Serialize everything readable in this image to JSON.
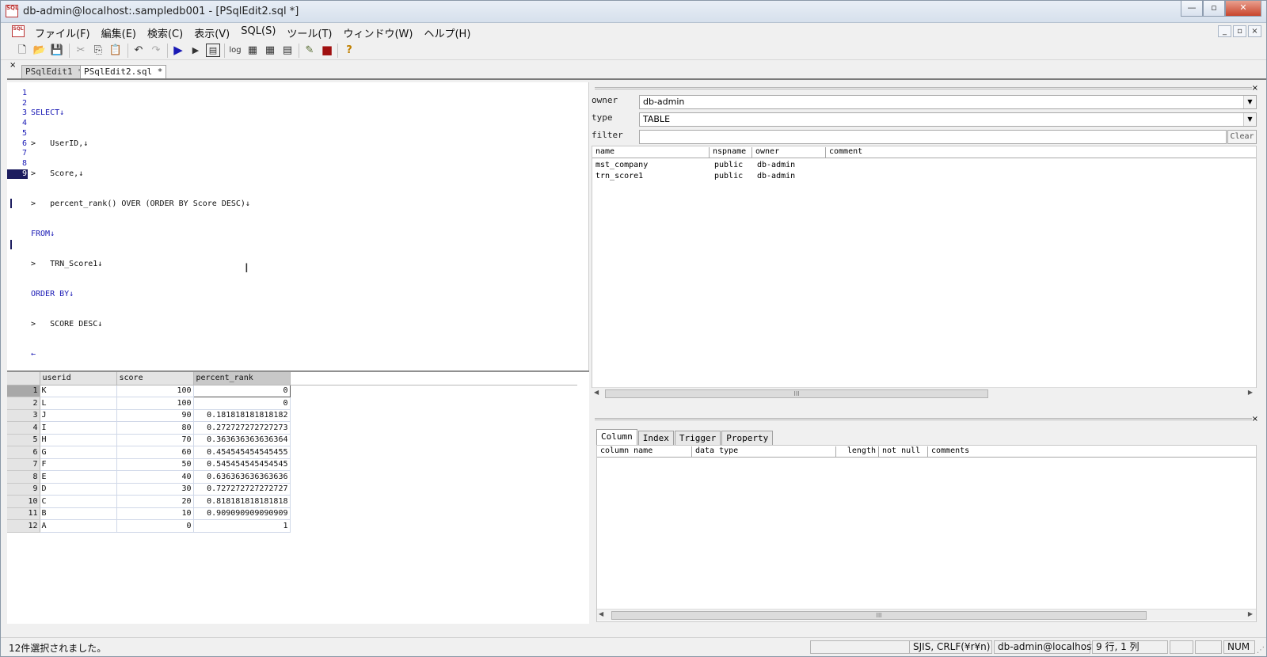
{
  "window": {
    "title": "db-admin@localhost:.sampledb001 - [PSqlEdit2.sql *]",
    "app_icon_text": "SQL",
    "buttons": [
      "—",
      "▫",
      "✕"
    ]
  },
  "menubar": {
    "items": [
      "ファイル(F)",
      "編集(E)",
      "検索(C)",
      "表示(V)",
      "SQL(S)",
      "ツール(T)",
      "ウィンドウ(W)",
      "ヘルプ(H)"
    ],
    "mdi_buttons": [
      "_",
      "▫",
      "×"
    ]
  },
  "toolbar": {
    "items": [
      {
        "icon": "new-file-icon",
        "glyph": "🗋"
      },
      {
        "icon": "open-folder-icon",
        "glyph": "📂"
      },
      {
        "icon": "save-icon",
        "glyph": "💾"
      },
      {
        "icon": "cut-icon",
        "glyph": "✂"
      },
      {
        "icon": "copy-icon",
        "glyph": "⎘"
      },
      {
        "icon": "paste-icon",
        "glyph": "📋"
      },
      {
        "icon": "undo-icon",
        "glyph": "↶"
      },
      {
        "icon": "redo-icon",
        "glyph": "↷"
      },
      {
        "icon": "run-icon",
        "glyph": "▶"
      },
      {
        "icon": "run-step-icon",
        "glyph": "▶"
      },
      {
        "icon": "explain-icon",
        "glyph": "▤"
      },
      {
        "icon": "log-icon",
        "glyph": "log"
      },
      {
        "icon": "table-icon",
        "glyph": "▦"
      },
      {
        "icon": "grid-icon",
        "glyph": "▦"
      },
      {
        "icon": "form-icon",
        "glyph": "▤"
      },
      {
        "icon": "pencil-icon",
        "glyph": "✎"
      },
      {
        "icon": "stop-icon",
        "glyph": "■"
      },
      {
        "icon": "help-icon",
        "glyph": "?"
      }
    ]
  },
  "tabs": [
    {
      "label": "PSqlEdit1 *",
      "active": false
    },
    {
      "label": "PSqlEdit2.sql *",
      "active": true
    }
  ],
  "editor": {
    "lines": [
      {
        "num": "1",
        "text": "SELECT↓"
      },
      {
        "num": "2",
        "text": ">   UserID,↓"
      },
      {
        "num": "3",
        "text": ">   Score,↓"
      },
      {
        "num": "4",
        "text": ">   percent_rank() OVER (ORDER BY Score DESC)↓"
      },
      {
        "num": "5",
        "text": "FROM↓"
      },
      {
        "num": "6",
        "text": ">   TRN_Score1↓"
      },
      {
        "num": "7",
        "text": "ORDER BY↓"
      },
      {
        "num": "8",
        "text": ">   SCORE DESC↓"
      },
      {
        "num": "9",
        "text": "←"
      }
    ],
    "current_line": "9"
  },
  "result_grid": {
    "columns": [
      "userid",
      "score",
      "percent_rank"
    ],
    "rows": [
      {
        "n": "1",
        "userid": "K",
        "score": "100",
        "percent_rank": "0"
      },
      {
        "n": "2",
        "userid": "L",
        "score": "100",
        "percent_rank": "0"
      },
      {
        "n": "3",
        "userid": "J",
        "score": "90",
        "percent_rank": "0.181818181818182"
      },
      {
        "n": "4",
        "userid": "I",
        "score": "80",
        "percent_rank": "0.272727272727273"
      },
      {
        "n": "5",
        "userid": "H",
        "score": "70",
        "percent_rank": "0.363636363636364"
      },
      {
        "n": "6",
        "userid": "G",
        "score": "60",
        "percent_rank": "0.454545454545455"
      },
      {
        "n": "7",
        "userid": "F",
        "score": "50",
        "percent_rank": "0.545454545454545"
      },
      {
        "n": "8",
        "userid": "E",
        "score": "40",
        "percent_rank": "0.636363636363636"
      },
      {
        "n": "9",
        "userid": "D",
        "score": "30",
        "percent_rank": "0.727272727272727"
      },
      {
        "n": "10",
        "userid": "C",
        "score": "20",
        "percent_rank": "0.818181818181818"
      },
      {
        "n": "11",
        "userid": "B",
        "score": "10",
        "percent_rank": "0.909090909090909"
      },
      {
        "n": "12",
        "userid": "A",
        "score": "0",
        "percent_rank": "1"
      }
    ]
  },
  "object_panel": {
    "owner_label": "owner",
    "owner_value": "db-admin",
    "type_label": "type",
    "type_value": "TABLE",
    "filter_label": "filter",
    "filter_value": "",
    "clear_label": "Clear",
    "columns": [
      "name",
      "nspname",
      "owner",
      "comment"
    ],
    "rows": [
      {
        "name": "mst_company",
        "nspname": "public",
        "owner": "db-admin",
        "comment": ""
      },
      {
        "name": "trn_score1",
        "nspname": "public",
        "owner": "db-admin",
        "comment": ""
      }
    ]
  },
  "detail_panel": {
    "tabs": [
      "Column",
      "Index",
      "Trigger",
      "Property"
    ],
    "active_tab": "Column",
    "columns": [
      "column name",
      "data type",
      "length",
      "not null",
      "comments"
    ]
  },
  "statusbar": {
    "message": "12件選択されました。",
    "encoding": "SJIS, CRLF(¥r¥n)",
    "connection": "db-admin@localhost:",
    "position": "9 行, 1 列",
    "num": "NUM"
  },
  "colors": {
    "keyword": "#1a1ab5",
    "current_line_bg": "#1c1c5e",
    "run_icon": "#1a1ab5",
    "stop_icon": "#a01010"
  }
}
